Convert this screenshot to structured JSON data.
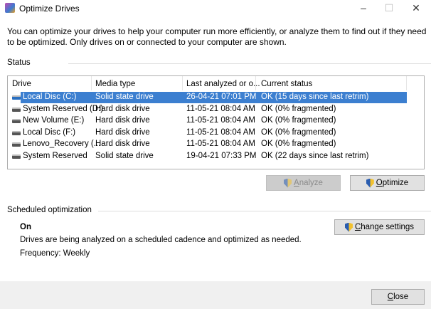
{
  "window": {
    "title": "Optimize Drives",
    "minimize": "–",
    "maximize": "☐",
    "close": "✕"
  },
  "description": "You can optimize your drives to help your computer run more efficiently, or analyze them to find out if they need to be optimized. Only drives on or connected to your computer are shown.",
  "status": {
    "label": "Status",
    "columns": [
      "Drive",
      "Media type",
      "Last analyzed or o...",
      "Current status"
    ],
    "rows": [
      {
        "drive": "Local Disc (C:)",
        "media": "Solid state drive",
        "last": "26-04-21 07:01 PM",
        "status": "OK (15 days since last retrim)",
        "selected": true
      },
      {
        "drive": "System Reserved (D:)",
        "media": "Hard disk drive",
        "last": "11-05-21 08:04 AM",
        "status": "OK (0% fragmented)"
      },
      {
        "drive": "New Volume (E:)",
        "media": "Hard disk drive",
        "last": "11-05-21 08:04 AM",
        "status": "OK (0% fragmented)"
      },
      {
        "drive": "Local Disc (F:)",
        "media": "Hard disk drive",
        "last": "11-05-21 08:04 AM",
        "status": "OK (0% fragmented)"
      },
      {
        "drive": "Lenovo_Recovery (...",
        "media": "Hard disk drive",
        "last": "11-05-21 08:04 AM",
        "status": "OK (0% fragmented)"
      },
      {
        "drive": "System Reserved",
        "media": "Solid state drive",
        "last": "19-04-21 07:33 PM",
        "status": "OK (22 days since last retrim)"
      }
    ]
  },
  "buttons": {
    "analyze_a": "A",
    "analyze_rest": "nalyze",
    "optimize_a": "O",
    "optimize_rest": "ptimize",
    "change_c": "C",
    "change_rest": "hange settings",
    "close_c": "C",
    "close_rest": "lose"
  },
  "scheduled": {
    "label": "Scheduled optimization",
    "state": "On",
    "text": "Drives are being analyzed on a scheduled cadence and optimized as needed.",
    "frequency": "Frequency: Weekly"
  },
  "colors": {
    "selection": "#3c7fd0"
  }
}
